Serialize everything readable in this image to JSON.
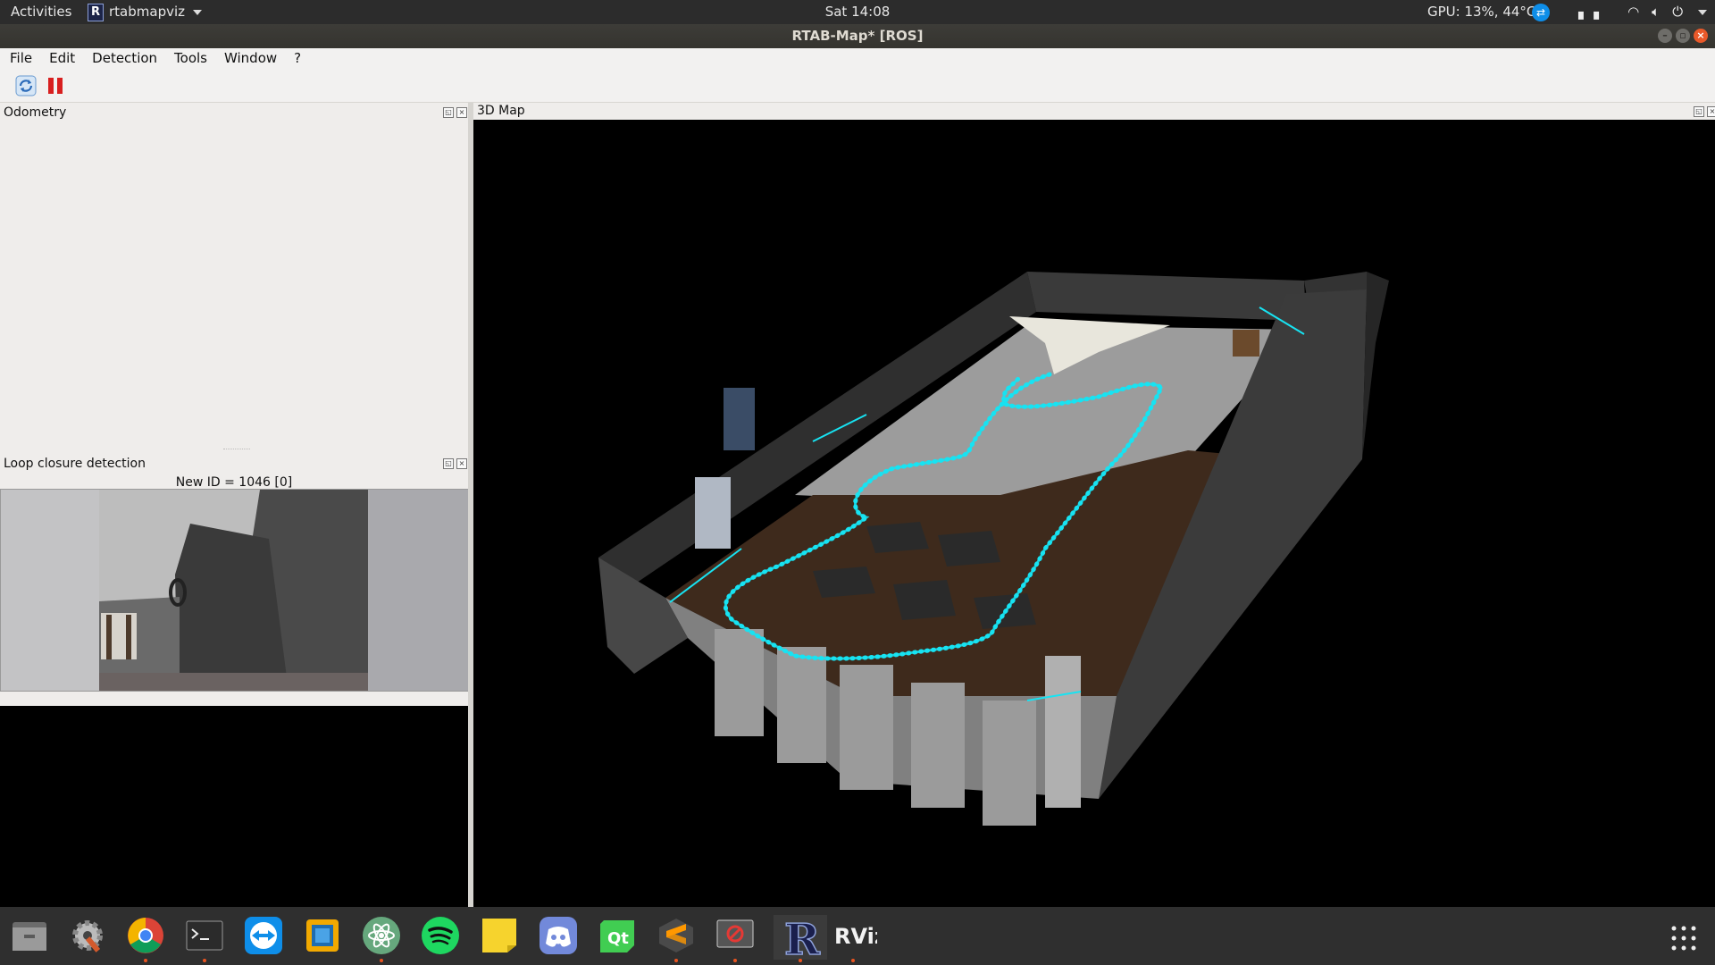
{
  "topbar": {
    "activities": "Activities",
    "app_name": "rtabmapviz",
    "clock": "Sat 14:08",
    "gpu_status": "GPU: 13%, 44°C"
  },
  "window": {
    "title": "RTAB-Map* [ROS]"
  },
  "menu": [
    "File",
    "Edit",
    "Detection",
    "Tools",
    "Window",
    "?"
  ],
  "toolbar": {
    "refresh_icon": "refresh-icon",
    "pause_icon": "pause-icon"
  },
  "docks": {
    "odometry_title": "Odometry",
    "loop_title": "Loop closure detection",
    "loop_new_id": "New ID = 1046 [0]",
    "map_title": "3D Map"
  },
  "taskbar": {
    "apps": [
      "files",
      "settings",
      "chrome",
      "terminal",
      "teamviewer",
      "virtualbox",
      "atom",
      "spotify",
      "sticky-notes",
      "discord",
      "qt-creator",
      "sublime-text",
      "screen-recorder",
      "rtabmap",
      "rviz"
    ],
    "running": [
      "chrome",
      "terminal",
      "atom",
      "sublime-text",
      "screen-recorder",
      "rtabmap",
      "rviz"
    ],
    "rviz_label": "RViz"
  },
  "colors": {
    "trajectory": "#17e3f2",
    "floor": "#3e2a1c",
    "accent": "#e95420"
  }
}
